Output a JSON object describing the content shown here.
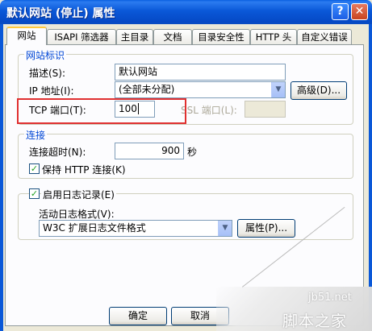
{
  "window": {
    "title": "默认网站 (停止) 属性",
    "help_glyph": "?",
    "close_glyph": "✕"
  },
  "tabs": [
    {
      "label": "网站",
      "active": true
    },
    {
      "label": "ISAPI 筛选器",
      "active": false
    },
    {
      "label": "主目录",
      "active": false
    },
    {
      "label": "文档",
      "active": false
    },
    {
      "label": "目录安全性",
      "active": false
    },
    {
      "label": "HTTP 头",
      "active": false
    },
    {
      "label": "自定义错误",
      "active": false
    }
  ],
  "site_identity": {
    "legend": "网站标识",
    "description_label": "描述(S):",
    "description_value": "默认网站",
    "ip_label": "IP 地址(I):",
    "ip_value": "(全部未分配)",
    "advanced_button": "高级(D)...",
    "tcp_label": "TCP 端口(T):",
    "tcp_value": "100",
    "ssl_label": "SSL 端口(L):",
    "ssl_value": ""
  },
  "connections": {
    "legend": "连接",
    "timeout_label": "连接超时(N):",
    "timeout_value": "900",
    "timeout_unit": "秒",
    "keepalive_label": "保持 HTTP 连接(K)",
    "keepalive_checked": true
  },
  "logging": {
    "enable_label": "启用日志记录(E)",
    "enable_checked": true,
    "format_label": "活动日志格式(V):",
    "format_value": "W3C 扩展日志文件格式",
    "properties_button": "属性(P)..."
  },
  "footer": {
    "ok_button": "确定",
    "cancel_button": "取消"
  },
  "watermark": {
    "site": "jb51.net",
    "brand": "脚本之家"
  },
  "colors": {
    "titlebar": "#0A58D8",
    "highlight_box": "#E03030",
    "legend_text": "#0046D5"
  }
}
